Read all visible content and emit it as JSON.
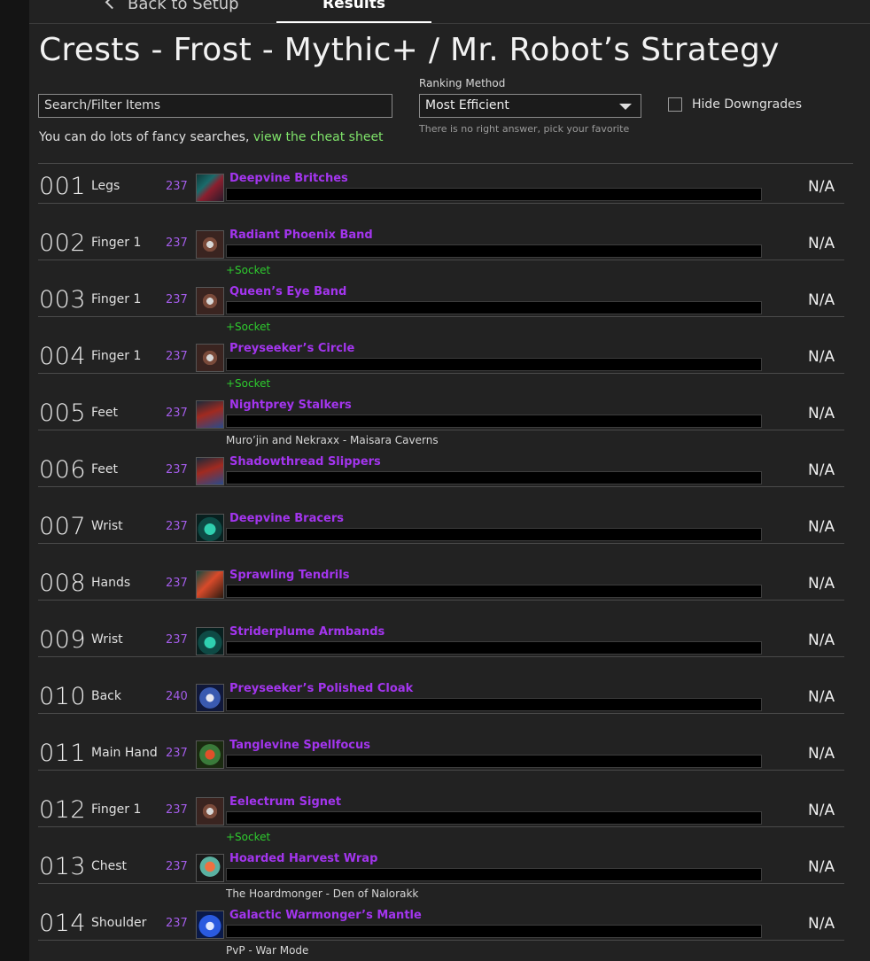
{
  "tabs": {
    "back_label": "Back to Setup",
    "results_label": "Results"
  },
  "page_title": "Crests - Frost - Mythic+ / Mr. Robot’s Strategy",
  "search": {
    "placeholder": "Search/Filter Items"
  },
  "hint": {
    "text": "You can do lots of fancy searches, ",
    "link": "view the cheat sheet"
  },
  "ranking": {
    "label": "Ranking Method",
    "value": "Most Efficient",
    "note": "There is no right answer, pick your favorite"
  },
  "hide_downgrades": {
    "label": "Hide Downgrades",
    "checked": false
  },
  "colors": {
    "epic": "#a335ee",
    "ilvl": "#a35ce8",
    "socket": "#2ecc2e",
    "link": "#7fe36a"
  },
  "items": [
    {
      "rank": "001",
      "slot": "Legs",
      "ilvl": "237",
      "name": "Deepvine Britches",
      "value": "N/A",
      "extra": "",
      "extra_type": "",
      "icon": "legs-icon"
    },
    {
      "rank": "002",
      "slot": "Finger 1",
      "ilvl": "237",
      "name": "Radiant Phoenix Band",
      "value": "N/A",
      "extra": "+Socket",
      "extra_type": "socket",
      "icon": "ring-icon"
    },
    {
      "rank": "003",
      "slot": "Finger 1",
      "ilvl": "237",
      "name": "Queen’s Eye Band",
      "value": "N/A",
      "extra": "+Socket",
      "extra_type": "socket",
      "icon": "ring-icon"
    },
    {
      "rank": "004",
      "slot": "Finger 1",
      "ilvl": "237",
      "name": "Preyseeker’s Circle",
      "value": "N/A",
      "extra": "+Socket",
      "extra_type": "socket",
      "icon": "ring-icon"
    },
    {
      "rank": "005",
      "slot": "Feet",
      "ilvl": "237",
      "name": "Nightprey Stalkers",
      "value": "N/A",
      "extra": "Muro’jin and Nekraxx - Maisara Caverns",
      "extra_type": "source",
      "icon": "boots-icon"
    },
    {
      "rank": "006",
      "slot": "Feet",
      "ilvl": "237",
      "name": "Shadowthread Slippers",
      "value": "N/A",
      "extra": "",
      "extra_type": "",
      "icon": "boots-icon"
    },
    {
      "rank": "007",
      "slot": "Wrist",
      "ilvl": "237",
      "name": "Deepvine Bracers",
      "value": "N/A",
      "extra": "",
      "extra_type": "",
      "icon": "bracers-icon"
    },
    {
      "rank": "008",
      "slot": "Hands",
      "ilvl": "237",
      "name": "Sprawling Tendrils",
      "value": "N/A",
      "extra": "",
      "extra_type": "",
      "icon": "gloves-icon"
    },
    {
      "rank": "009",
      "slot": "Wrist",
      "ilvl": "237",
      "name": "Striderplume Armbands",
      "value": "N/A",
      "extra": "",
      "extra_type": "",
      "icon": "bracers-icon"
    },
    {
      "rank": "010",
      "slot": "Back",
      "ilvl": "240",
      "name": "Preyseeker’s Polished Cloak",
      "value": "N/A",
      "extra": "",
      "extra_type": "",
      "icon": "cloak-icon"
    },
    {
      "rank": "011",
      "slot": "Main Hand",
      "ilvl": "237",
      "name": "Tanglevine Spellfocus",
      "value": "N/A",
      "extra": "",
      "extra_type": "",
      "icon": "weapon-icon"
    },
    {
      "rank": "012",
      "slot": "Finger 1",
      "ilvl": "237",
      "name": "Eelectrum Signet",
      "value": "N/A",
      "extra": "+Socket",
      "extra_type": "socket",
      "icon": "ring-icon"
    },
    {
      "rank": "013",
      "slot": "Chest",
      "ilvl": "237",
      "name": "Hoarded Harvest Wrap",
      "value": "N/A",
      "extra": "The Hoardmonger - Den of Nalorakk",
      "extra_type": "source",
      "icon": "chest-icon"
    },
    {
      "rank": "014",
      "slot": "Shoulder",
      "ilvl": "237",
      "name": "Galactic Warmonger’s Mantle",
      "value": "N/A",
      "extra": "PvP - War Mode",
      "extra_type": "source",
      "icon": "shoulder-icon"
    }
  ]
}
